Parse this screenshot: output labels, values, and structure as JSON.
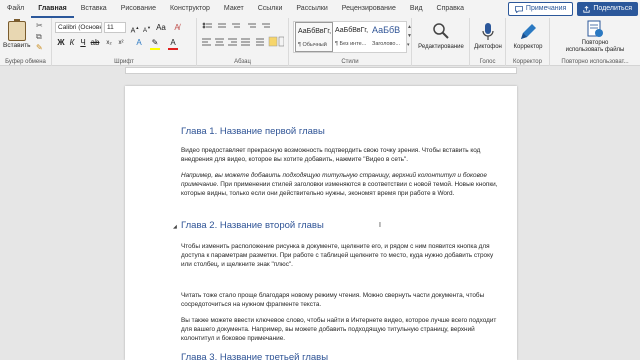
{
  "tabs": [
    "Файл",
    "Главная",
    "Вставка",
    "Рисование",
    "Конструктор",
    "Макет",
    "Ссылки",
    "Рассылки",
    "Рецензирование",
    "Вид",
    "Справка"
  ],
  "tab_actions": {
    "comments": "Примечания",
    "share": "Поделиться"
  },
  "ribbon": {
    "clipboard": {
      "paste": "Вставить",
      "label": "Буфер обмена"
    },
    "font": {
      "name": "Calibri (Основн",
      "size": "11",
      "label": "Шрифт",
      "bold": "Ж",
      "italic": "К",
      "underline": "Ч"
    },
    "paragraph": {
      "label": "Абзац"
    },
    "styles": {
      "items": [
        {
          "preview": "АаБбВвГг,",
          "name": "¶ Обычный"
        },
        {
          "preview": "АаБбВвГг,",
          "name": "¶ Без инте..."
        },
        {
          "preview": "АаБбВ",
          "name": "Заголово..."
        }
      ],
      "label": "Стили"
    },
    "editing": {
      "label": "Редактирование"
    },
    "voice": {
      "dictate": "Диктофон",
      "label": "Голос"
    },
    "editor": {
      "name": "Корректор",
      "label": "Корректор"
    },
    "reuse": {
      "name_line1": "Повторно",
      "name_line2": "использовать файлы",
      "label": "Повторно использоват..."
    }
  },
  "document": {
    "heading1": "Глава 1. Название первой главы",
    "p1": "Видео предоставляет прекрасную возможность подтвердить свою точку зрения. Чтобы вставить код внедрения для видео, которое вы хотите добавить, нажмите \"Видео в сеть\".",
    "p2_italic": "Например, вы можете добавить подходящую титульную страницу, верхний колонтитул и боковое примечание.",
    "p2_rest": " При применении стилей заголовки изменяются в соответствии с новой темой. Новые кнопки, которые видны, только если они действительно нужны, экономят время при работе в Word.",
    "heading2": "Глава 2. Название второй главы",
    "p3": "Чтобы изменить расположение рисунка в документе, щелкните его, и рядом с ним появится кнопка для доступа к параметрам разметки. При работе с таблицей щелкните то место, куда нужно добавить строку или столбец, и щелкните знак \"плюс\".",
    "p4": "Читать тоже стало проще благодаря новому режиму чтения. Можно свернуть части документа, чтобы сосредоточиться на нужном фрагменте текста.",
    "p5": "Вы также можете ввести ключевое слово, чтобы найти в Интернете видео, которое лучше всего подходит для вашего документа. Например, вы можете добавить подходящую титульную страницу, верхний колонтитул и боковое примечание.",
    "heading3": "Глава 3. Название третьей главы"
  }
}
